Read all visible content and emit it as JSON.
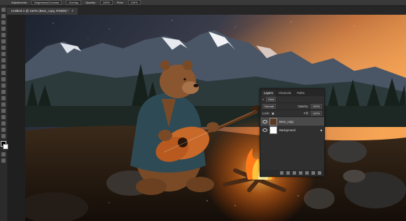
{
  "options_bar": {
    "adjustment_label": "Adjustments:",
    "adjustment_value": "Brightness/Contrast",
    "mode_value": "Overlay",
    "opacity_label": "Opacity:",
    "opacity_value": "100%",
    "flow_label": "Flow:",
    "flow_value": "100%"
  },
  "document": {
    "tab_title": "Untitled-1 @ 150% (Bear_copy, RGB/8) *",
    "close_label": "×"
  },
  "layers_panel": {
    "tabs": [
      "Layers",
      "Channels",
      "Paths"
    ],
    "filter_kind": "Kind",
    "blend_mode": "Normal",
    "opacity_label": "Opacity:",
    "opacity_value": "100%",
    "lock_label": "Lock:",
    "fill_label": "Fill:",
    "fill_value": "100%",
    "layers": [
      {
        "name": "Bear_copy",
        "selected": true
      },
      {
        "name": "Background",
        "selected": false
      }
    ]
  },
  "colors": {
    "sky_top": "#1e2733",
    "sunset": "#f08a3a",
    "fire": "#ff8a1e",
    "guitar": "#c8692a"
  }
}
